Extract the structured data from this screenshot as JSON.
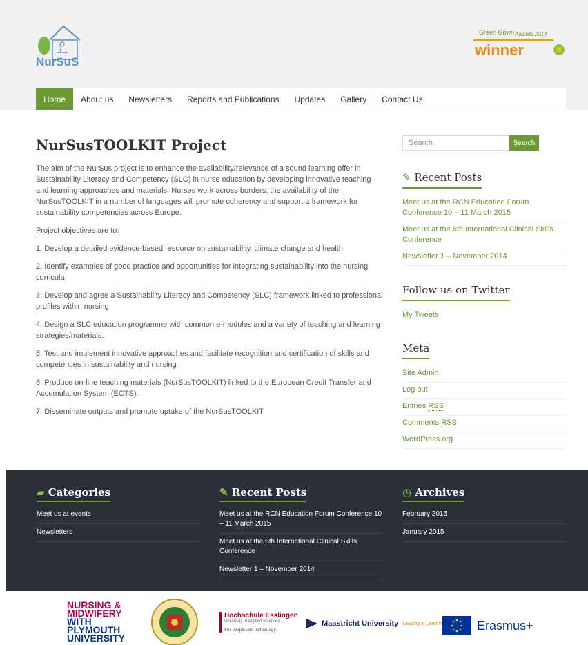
{
  "header": {
    "logo_text": "NurSuS",
    "award": {
      "line1": "Green Gown",
      "line2": "Awards 2014",
      "word": "winner"
    },
    "nav": [
      {
        "label": "Home",
        "active": true
      },
      {
        "label": "About us"
      },
      {
        "label": "Newsletters"
      },
      {
        "label": "Reports and Publications"
      },
      {
        "label": "Updates"
      },
      {
        "label": "Gallery"
      },
      {
        "label": "Contact Us"
      }
    ]
  },
  "main": {
    "title": "NurSusTOOLKIT Project",
    "paragraphs": [
      "The aim of the NurSus project is to enhance the availability/relevance of a sound learning offer in Sustainability Literacy and Competency (SLC) in nurse education by developing innovative teaching and learning approaches and materials. Nurses work across borders; the availability of the NurSusTOOLKIT in a number of languages will promote coherency and support a framework for sustainability competencies across Europe.",
      "Project objectives are to:",
      "1. Develop a detailed evidence-based resource on sustainability, climate change and health",
      "2. Identify examples of good practice and opportunities for integrating sustainability into the nursing curricula",
      "3. Develop and agree a Sustainability Literacy and Competency (SLC) framework linked to professional profiles within nursing",
      "4. Design a SLC education programme with common e-modules and a variety of teaching and learning strategies/materials.",
      "5. Test and implement innovative approaches and facilitate recognition and certification of skills and competences in sustainability and nursing.",
      "6. Produce on-line teaching materials (NurSusTOOLKIT) linked to the European Credit Transfer and Accumulation System (ECTS).",
      "7. Disseminate outputs and promote uptake of the NurSusTOOLKIT"
    ]
  },
  "sidebar": {
    "search_placeholder": "Search",
    "search_button": "Search",
    "recent_title": "Recent Posts",
    "recent": [
      "Meet us at the RCN Education Forum Conference 10 – 11 March 2015",
      "Meet us at the 6th International Clinical Skills Conference",
      "Newsletter 1 – November 2014"
    ],
    "twitter_title": "Follow us on Twitter",
    "twitter_link": "My Tweets",
    "meta_title": "Meta",
    "meta": {
      "site_admin": "Site Admin",
      "log_out": "Log out",
      "entries": "Entries",
      "comments": "Comments",
      "rss": "RSS",
      "wordpress": "WordPress.org"
    }
  },
  "footer": {
    "categories_title": "Categories",
    "categories": [
      "Meet us at events",
      "Newsletters"
    ],
    "recent_title": "Recent Posts",
    "recent": [
      "Meet us at the RCN Education Forum Conference 10 – 11 March 2015",
      "Meet us at the 6th International Clinical Skills Conference",
      "Newsletter 1 – November 2014"
    ],
    "archives_title": "Archives",
    "archives": [
      "February 2015",
      "January 2015"
    ]
  },
  "partners": {
    "plymouth": [
      "NURSING &",
      "MIDWIFERY",
      "WITH",
      "PLYMOUTH",
      "UNIVERSITY"
    ],
    "esslingen": {
      "name": "Hochschule Esslingen",
      "sub": "University of Applied Sciences",
      "tag": "For people and technology."
    },
    "maastricht": {
      "name": "Maastricht University",
      "tag": "Leading in Learning!"
    },
    "erasmus": "Erasmus+"
  },
  "colors": {
    "accent": "#6a9a32",
    "footer_bg": "#2a2f38"
  }
}
